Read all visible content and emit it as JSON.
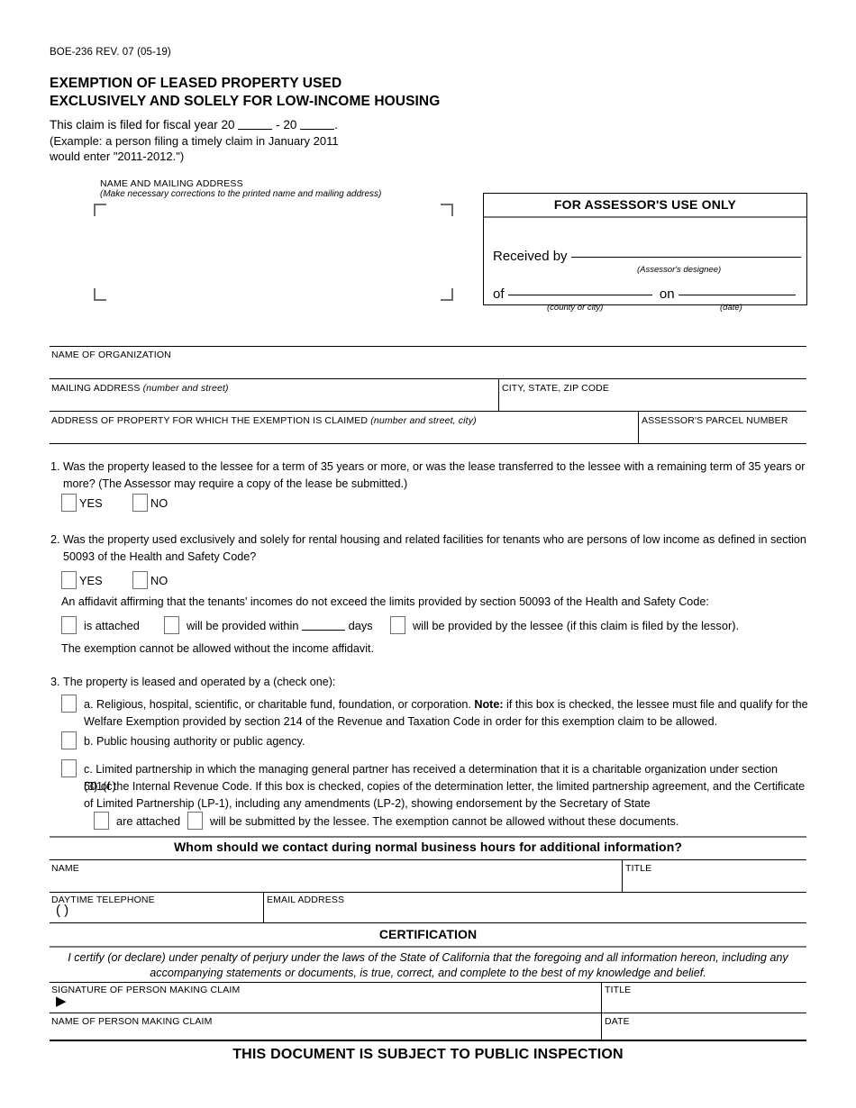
{
  "document": {
    "form_code": "BOE-236 REV. 07 (05-19)",
    "title_line1": "EXEMPTION OF LEASED PROPERTY USED",
    "title_line2": "EXCLUSIVELY AND SOLELY FOR LOW-INCOME HOUSING",
    "fiscal_prefix": "This claim is filed for fiscal year 20",
    "fiscal_mid": "- 20",
    "fiscal_period": ".",
    "fiscal_example_line1": "(Example: a person filing a timely claim in January 2011",
    "fiscal_example_line2": "would enter \"2011-2012.\")",
    "footer": "THIS DOCUMENT IS SUBJECT TO PUBLIC INSPECTION"
  },
  "name_address_block": {
    "label": "NAME AND MAILING ADDRESS",
    "sub_label": "(Make necessary corrections to the printed name and mailing address)"
  },
  "assessor_box": {
    "heading": "FOR ASSESSOR'S USE ONLY",
    "received_by_label": "Received by",
    "designee_caption": "(Assessor's designee)",
    "of_label": "of",
    "county_caption": "(county or city)",
    "on_label": "on",
    "date_caption": "(date)"
  },
  "org_fields": {
    "name_of_organization": "NAME OF ORGANIZATION",
    "mailing_address": "MAILING ADDRESS",
    "mailing_address_hint": "(number and street)",
    "city_state_zip": "CITY, STATE, ZIP CODE",
    "property_address": "ADDRESS OF PROPERTY FOR WHICH THE EXEMPTION IS CLAIMED",
    "property_address_hint": "(number and street, city)",
    "parcel_number": "ASSESSOR'S PARCEL NUMBER"
  },
  "question1": {
    "number": "1.",
    "line1": "Was the property leased to the lessee for a term of 35 years or more, or was the lease transferred to the lessee with a remaining term of 35 years or",
    "line2": "more? (The Assessor may require a copy of the lease be submitted.)",
    "yes": "YES",
    "no": "NO"
  },
  "question2": {
    "number": "2.",
    "line1": "Was the property used exclusively and solely for rental housing and related facilities for tenants who are persons of low income as defined in section",
    "line2": "50093 of the Health and Safety Code?",
    "yes": "YES",
    "no": "NO",
    "affidavit_intro": "An affidavit affirming that the tenants' incomes do not exceed the limits provided by section 50093 of the Health and Safety Code:",
    "opt_is_attached": "is attached",
    "opt_will_be_provided_within": "will be provided within",
    "opt_days": "days",
    "opt_will_be_provided_by_lessee": "will be provided by the lessee (if this claim is filed by the lessor).",
    "closing": "The exemption cannot be allowed without the income affidavit."
  },
  "question3": {
    "number": "3.",
    "intro": "The property is leased and operated by a (check one):",
    "option_a_part1": "a. Religious, hospital, scientific, or charitable fund, foundation, or corporation. ",
    "option_a_note": "Note:",
    "option_a_part2": " if this box is checked, the lessee must file and qualify for the",
    "option_a_line2": "Welfare Exemption provided by section 214 of the Revenue and Taxation Code in order for this exemption claim to be allowed.",
    "option_b": "b. Public housing authority or public agency.",
    "option_c_line1": "c. Limited partnership in which the managing general partner has received a determination that it is a charitable organization under section 501(c)",
    "option_c_line2": "(3) of the Internal Revenue Code. If this box is checked, copies of the determination letter, the limited partnership agreement, and the Certificate",
    "option_c_line3": "of Limited Partnership (LP-1), including any amendments (LP-2), showing endorsement by the Secretary of State",
    "sub_are_attached": "are attached",
    "sub_will_be_submitted": "will be submitted by the lessee. The exemption cannot be allowed without these documents."
  },
  "contact": {
    "heading": "Whom should we contact during normal business hours for additional information?",
    "name": "NAME",
    "title": "TITLE",
    "daytime_telephone": "DAYTIME TELEPHONE",
    "phone_value": "(          )",
    "email_address": "EMAIL ADDRESS"
  },
  "certification": {
    "heading": "CERTIFICATION",
    "text_line1": "I certify (or declare) under penalty of perjury under the laws of the State of California that the foregoing and all information hereon, including any",
    "text_line2": "accompanying statements or documents, is true, correct, and complete to the best of my knowledge and belief.",
    "signature_label": "SIGNATURE OF PERSON MAKING CLAIM",
    "signature_arrow": "▶",
    "title_label": "TITLE",
    "name_label": "NAME OF PERSON MAKING CLAIM",
    "date_label": "DATE"
  },
  "colors": {
    "ink": "#000000",
    "checkbox_border": "#6e6e6e",
    "rule": "#000000"
  }
}
